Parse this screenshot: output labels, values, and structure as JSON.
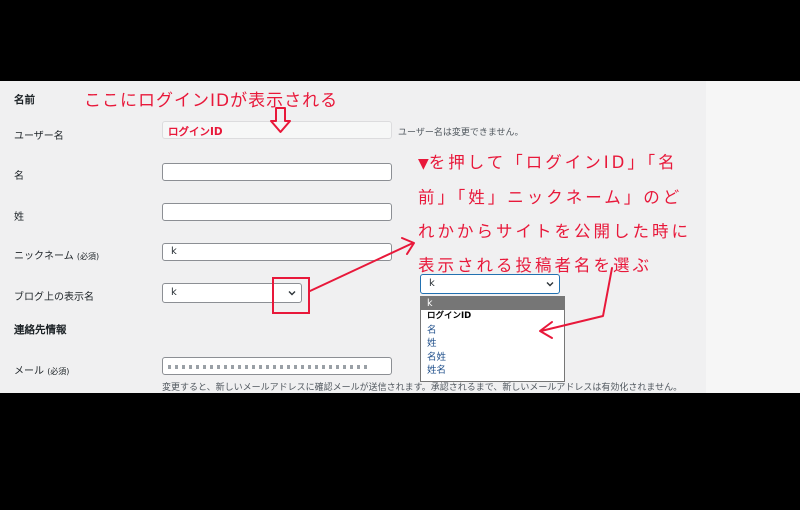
{
  "form": {
    "section_name": "名前",
    "username_label": "ユーザー名",
    "username_value": "ログインID",
    "username_note": "ユーザー名は変更できません。",
    "firstname_label": "名",
    "lastname_label": "姓",
    "nickname_label": "ニックネーム",
    "nickname_required": "(必須)",
    "nickname_value": "k",
    "display_label": "ブログ上の表示名",
    "display_value": "k",
    "section_contact": "連絡先情報",
    "email_label": "メール",
    "email_required": "(必須)",
    "email_note": "変更すると、新しいメールアドレスに確認メールが送信されます。承認されるまで、新しいメールアドレスは有効化されません。"
  },
  "dropdown": {
    "selected": "k",
    "options": [
      "k",
      "ログインID",
      "名",
      "姓",
      "名姓",
      "姓名"
    ]
  },
  "annotations": {
    "top": "ここにログインIDが表示される",
    "tri": "▼",
    "line1": "を押して「ログインID」「名",
    "line2": "前」「姓」ニックネーム」のど",
    "line3": "れかからサイトを公開した時に",
    "line4": "表示される投稿者名を選ぶ"
  },
  "colors": {
    "annotation": "#e8183a",
    "background": "#000000",
    "panel": "#f0f0f1"
  }
}
